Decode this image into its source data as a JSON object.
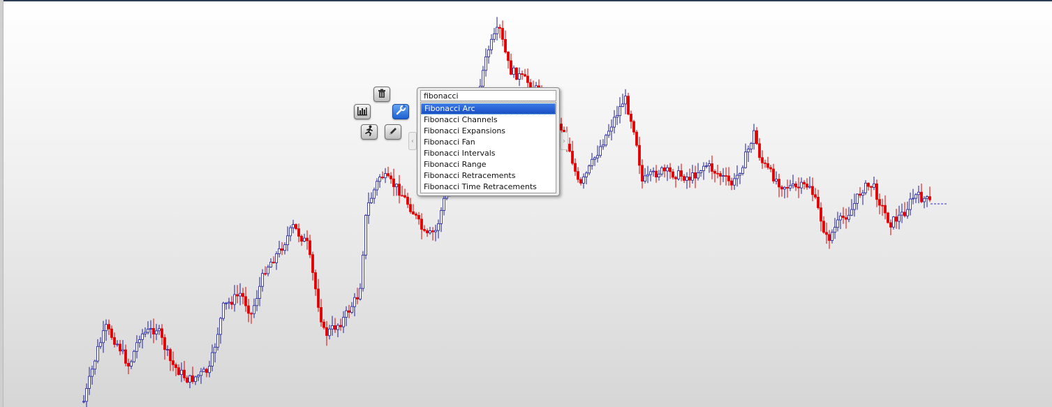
{
  "search": {
    "value": "fibonacci",
    "results": [
      "Fibonacci Arc",
      "Fibonacci Channels",
      "Fibonacci Expansions",
      "Fibonacci Fan",
      "Fibonacci Intervals",
      "Fibonacci Range",
      "Fibonacci Retracements",
      "Fibonacci Time Retracements"
    ],
    "selected_index": 0
  },
  "toolbar": {
    "delete_icon": "trash-icon",
    "indicators_icon": "bar-chart-icon",
    "properties_icon": "wrench-icon",
    "run_icon": "running-man-icon",
    "draw_icon": "pencil-icon",
    "active": "properties"
  },
  "chart": {
    "type": "candlestick",
    "up_color": "#1a1aa6",
    "down_color": "#e00000",
    "last_price_line_color": "#2b2bc9"
  },
  "colors": {
    "selection": "#1a4fc4",
    "active_button": "#1b5fd1"
  }
}
